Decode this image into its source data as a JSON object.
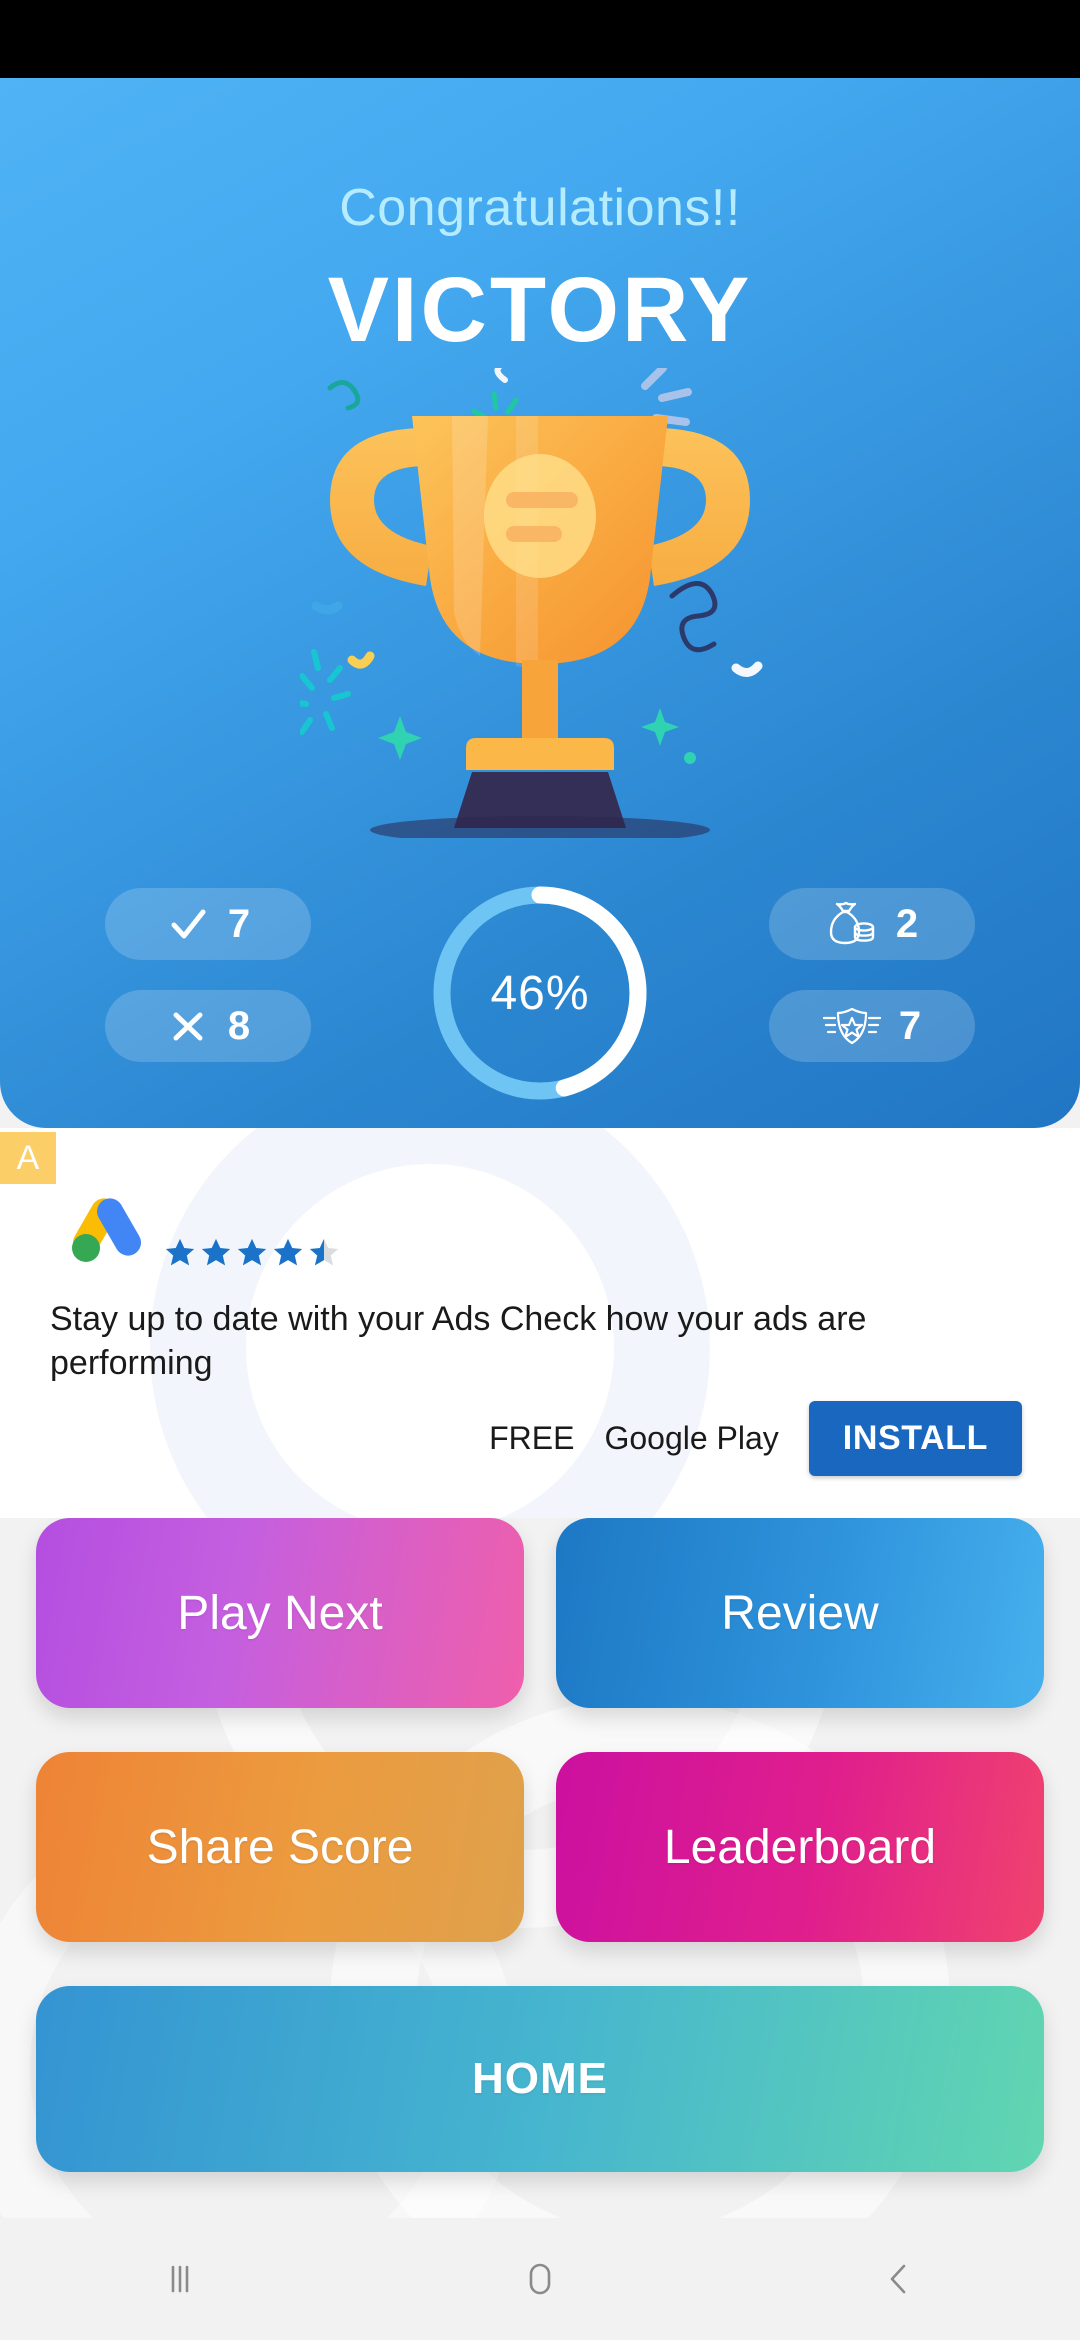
{
  "status_bar": {
    "background": "#000000"
  },
  "victory": {
    "congrats_text": "Congratulations!!",
    "title": "VICTORY",
    "trophy_icon": "trophy-icon",
    "accent_gradient_from": "#4fb3f5",
    "accent_gradient_to": "#2176c4"
  },
  "stats": {
    "left": [
      {
        "icon": "check-icon",
        "value": "7"
      },
      {
        "icon": "cross-icon",
        "value": "8"
      }
    ],
    "right": [
      {
        "icon": "money-bag-icon",
        "value": "2"
      },
      {
        "icon": "badge-shield-icon",
        "value": "7"
      }
    ],
    "progress": {
      "label": "46%",
      "percent": 46,
      "track_color": "#6ec4f3",
      "fill_color": "#ffffff"
    }
  },
  "ad": {
    "badge_label": "A",
    "badge_color": "#fcce68",
    "logo_icon": "google-ads-logo-icon",
    "rating": 4.5,
    "rating_star_color": "#1a73c8",
    "rating_star_empty_color": "#dadce0",
    "headline": "Stay up to date with your Ads Check how your ads are performing",
    "price_label": "FREE",
    "store_label": "Google Play",
    "install_label": "INSTALL",
    "install_color": "#1967bf"
  },
  "actions": {
    "rows": [
      [
        {
          "label": "Play Next",
          "style": "play"
        },
        {
          "label": "Review",
          "style": "review"
        }
      ],
      [
        {
          "label": "Share Score",
          "style": "share"
        },
        {
          "label": "Leaderboard",
          "style": "leader"
        }
      ]
    ],
    "home_label": "HOME"
  },
  "nav_bar": {
    "recents_icon": "recents-icon",
    "home_icon": "home-icon",
    "back_icon": "back-icon",
    "icon_color": "#8a8a8a"
  }
}
